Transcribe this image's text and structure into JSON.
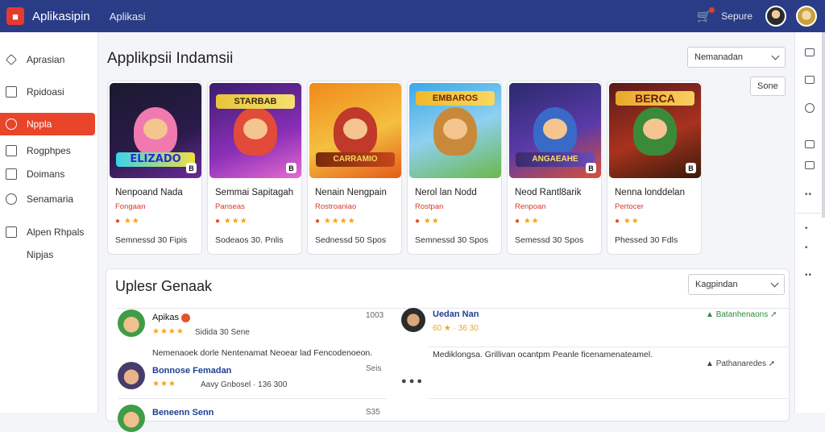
{
  "header": {
    "app_name": "Aplikasipin",
    "nav_link": "Aplikasi",
    "right_link": "Sepure",
    "logo_glyph": "■",
    "cart_icon": "cart-icon"
  },
  "sidebar": {
    "items": [
      {
        "label": "Aprasian",
        "icon": "diamond-icon"
      },
      {
        "label": "Rpidoasi",
        "icon": "document-icon"
      },
      {
        "label": "Nppla",
        "icon": "circle-icon",
        "active": true
      },
      {
        "label": "Rogphpes",
        "icon": "image-icon"
      },
      {
        "label": "Doimans",
        "icon": "list-icon"
      },
      {
        "label": "Senamaria",
        "icon": "gamepad-icon"
      },
      {
        "label": "Alpen Rhpals",
        "icon": "folder-icon"
      },
      {
        "label": "Nipjas",
        "icon": ""
      }
    ]
  },
  "main": {
    "title": "Applikpsii Indamsii",
    "filter_select": "Nemanadan",
    "sort_select": "Sone"
  },
  "cards": [
    {
      "name": "Nenpoand Nada",
      "sub": "Fongaan",
      "stars": "★★",
      "meta": "Semnessd 30 Fipis",
      "tag": "B",
      "banner_text": "ELIZADO"
    },
    {
      "name": "Semmai Sapitagah",
      "sub": "Panseas",
      "stars": "★★★",
      "meta": "Sodeaos 30. Pnlis",
      "tag": "B",
      "banner_text": "STARBAB"
    },
    {
      "name": "Nenain Nengpain",
      "sub": "Rostroaniao",
      "stars": "★★★★",
      "meta": "Sednessd 50 Spos",
      "tag": "",
      "banner_text": "CARRAMIO"
    },
    {
      "name": "Nerol lan Nodd",
      "sub": "Rostpan",
      "stars": "★★",
      "meta": "Semnessd 30 Spos",
      "tag": "",
      "banner_text": "EMBAROS"
    },
    {
      "name": "Neod Rantl8arik",
      "sub": "Renpoan",
      "stars": "★★",
      "meta": "Semessd 30 Spos",
      "tag": "B",
      "banner_text": "ANGAEAHE"
    },
    {
      "name": "Nenna londdelan",
      "sub": "Pertocer",
      "stars": "★★",
      "meta": "Phessed 30 Fdls",
      "tag": "B",
      "banner_text": "BERCA"
    }
  ],
  "reviews": {
    "title": "Uplesr Genaak",
    "select": "Kagpindan",
    "left": [
      {
        "name": "Apikas",
        "stars": "★★★★",
        "meta": "Sidida 30 Sene",
        "time": "1003",
        "text": "Nemenaoek dorle Nentenamat Neoear lad Fencodenoeon."
      },
      {
        "name": "Bonnose Femadan",
        "stars": "★★★",
        "meta": "Aavy Gnbosel · 136 300",
        "time": "Seis",
        "text": ""
      },
      {
        "name": "Beneenn Senn",
        "stars": "",
        "meta": "",
        "time": "S35",
        "text": ""
      }
    ],
    "right": [
      {
        "name": "Uedan Nan",
        "stars": "★★★",
        "meta": "60 ★ · 36 30",
        "action": "Batanhenaons",
        "text": "Mediklongsa. Grillivan ocantpm Peanle ficenamenateamel."
      },
      {
        "name": "",
        "stars": "",
        "meta": "",
        "action": "Pathanaredes",
        "text": ""
      }
    ],
    "reaction_icons": "thumbs-icons"
  },
  "colors": {
    "topbar": "#2a3c86",
    "accent": "#e8452a",
    "star": "#f2a51c",
    "link_blue": "#1f3f92",
    "green": "#2e8a3d"
  }
}
